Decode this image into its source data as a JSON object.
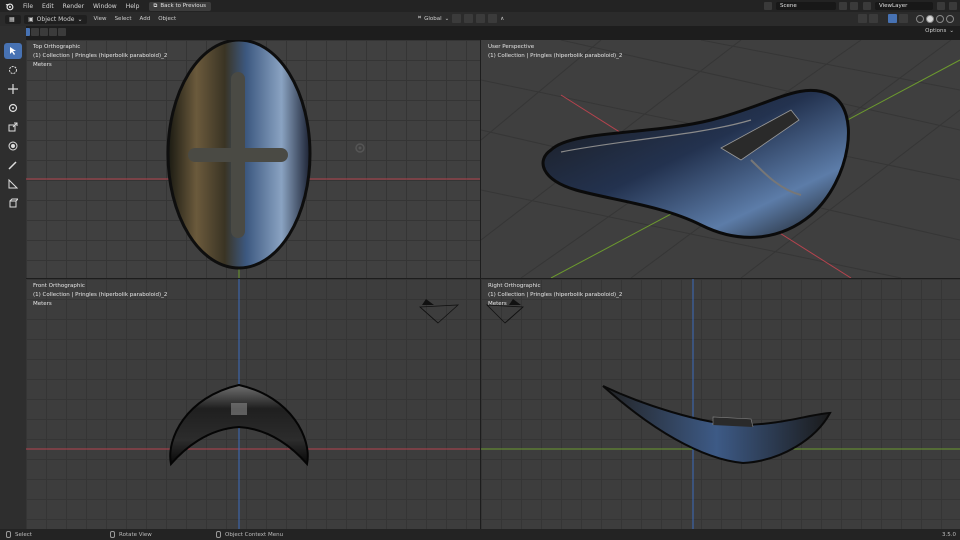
{
  "menubar": {
    "items": [
      "File",
      "Edit",
      "Render",
      "Window",
      "Help"
    ],
    "back_button": "Back to Previous",
    "scene": "Scene",
    "view_layer": "ViewLayer"
  },
  "header": {
    "mode": "Object Mode",
    "menus": [
      "View",
      "Select",
      "Add",
      "Object"
    ],
    "orientation": "Global",
    "options": "Options"
  },
  "viewports": {
    "top": {
      "title": "Top Orthographic",
      "collection": "(1) Collection | Pringles (hiperbolik paraboloid)_2",
      "units": "Meters"
    },
    "persp": {
      "title": "User Perspective",
      "collection": "(1) Collection | Pringles (hiperbolik paraboloid)_2"
    },
    "front": {
      "title": "Front Orthographic",
      "collection": "(1) Collection | Pringles (hiperbolik paraboloid)_2",
      "units": "Meters"
    },
    "right": {
      "title": "Right Orthographic",
      "collection": "(1) Collection | Pringles (hiperbolik paraboloid)_2",
      "units": "Meters"
    }
  },
  "statusbar": {
    "select": "Select",
    "rotate": "Rotate View",
    "context": "Object Context Menu",
    "version": "3.5.0"
  },
  "tools": [
    "select-box-icon",
    "cursor-icon",
    "move-icon",
    "rotate-icon",
    "scale-icon",
    "transform-icon",
    "annotate-icon",
    "measure-icon",
    "add-cube-icon"
  ],
  "colors": {
    "x_axis": "#b5434e",
    "y_axis": "#6c9a2e",
    "z_axis": "#3c6bbd",
    "accent": "#4772b3"
  }
}
